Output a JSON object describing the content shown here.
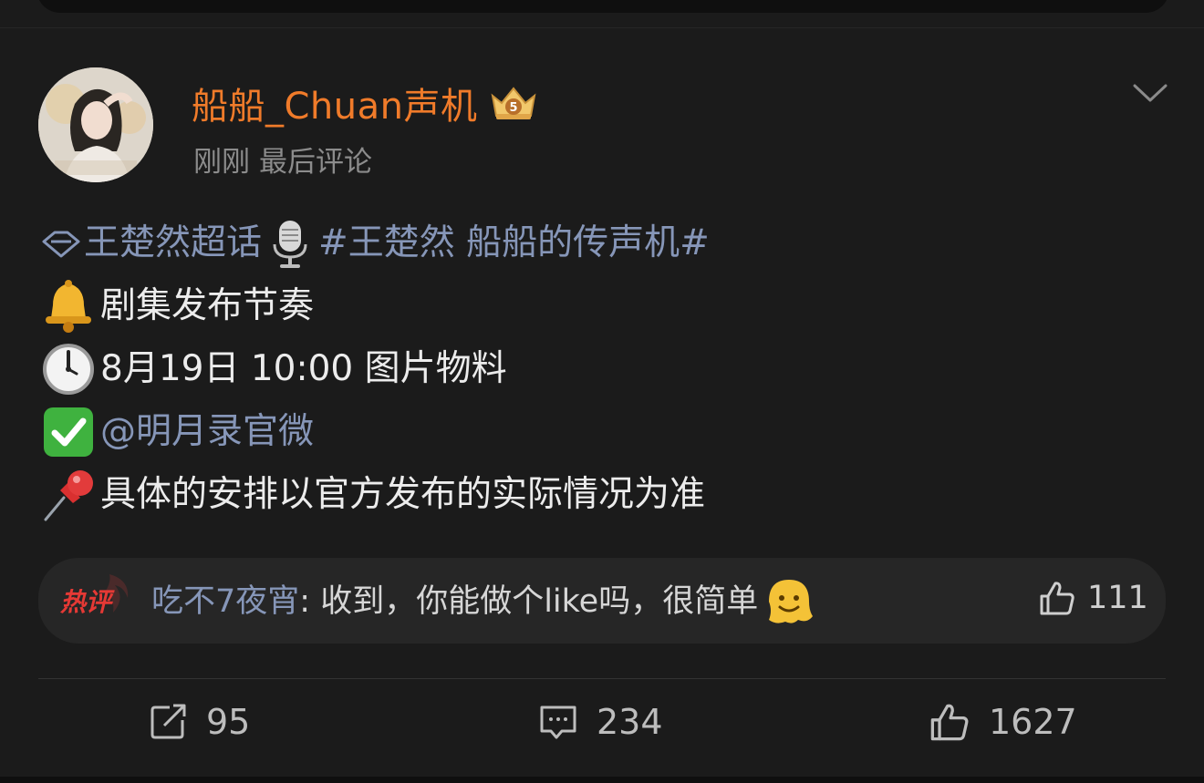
{
  "post": {
    "username": "船船_Chuan声机",
    "time": "刚刚",
    "status": "最后评论",
    "lines": {
      "topic_super": "王楚然超话",
      "topic_hashtag": "#王楚然 船船的传声机#",
      "notice": "剧集发布节奏",
      "schedule": "8月19日 10:00 图片物料",
      "mention": "@明月录官微",
      "note": "具体的安排以官方发布的实际情况为准"
    }
  },
  "hot_comment": {
    "tag": "热评",
    "user": "吃不7夜宵",
    "separator": ": ",
    "text": "收到，你能做个like吗，很简单",
    "likes": "111"
  },
  "actions": {
    "repost_count": "95",
    "comment_count": "234",
    "like_count": "1627"
  },
  "colors": {
    "background": "#1b1b1b",
    "username": "#f07b2a",
    "link": "#8696b8",
    "hot_tag": "#e53935"
  }
}
